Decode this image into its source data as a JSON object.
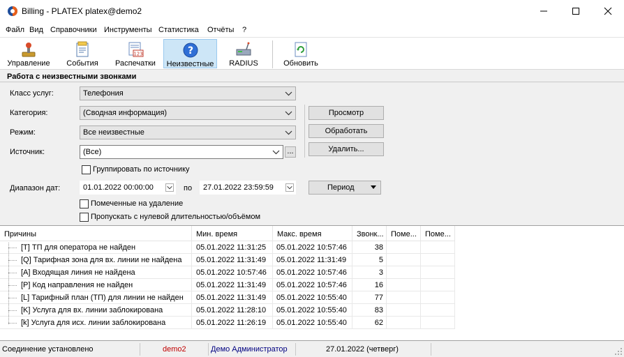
{
  "window": {
    "title": "Billing - PLATEX platex@demo2"
  },
  "menu": [
    "Файл",
    "Вид",
    "Справочники",
    "Инструменты",
    "Статистика",
    "Отчёты",
    "?"
  ],
  "toolbar": {
    "buttons": [
      {
        "label": "Управление",
        "icon": "joystick-icon"
      },
      {
        "label": "События",
        "icon": "events-icon"
      },
      {
        "label": "Распечатки",
        "icon": "printouts-icon",
        "badge": "123"
      },
      {
        "label": "Неизвестные",
        "icon": "question-icon",
        "active": true
      },
      {
        "label": "RADIUS",
        "icon": "radius-server-icon"
      },
      {
        "label": "Обновить",
        "icon": "refresh-icon"
      }
    ]
  },
  "section": {
    "title": "Работа с неизвестными звонками"
  },
  "form": {
    "service_class_label": "Класс услуг:",
    "service_class_value": "Телефония",
    "category_label": "Категория:",
    "category_value": "(Сводная информация)",
    "mode_label": "Режим:",
    "mode_value": "Все неизвестные",
    "source_label": "Источник:",
    "source_value": "(Все)",
    "browse_label": "...",
    "group_by_source_label": "Группировать по источнику",
    "date_range_label": "Диапазон дат:",
    "date_from": "01.01.2022 00:00:00",
    "date_to_label": "по",
    "date_to": "27.01.2022 23:59:59",
    "period_label": "Период",
    "marked_for_deletion_label": "Помеченные на удаление",
    "skip_zero_label": "Пропускать с нулевой длительностью/объёмом"
  },
  "actions": {
    "view": "Просмотр",
    "process": "Обработать",
    "delete": "Удалить..."
  },
  "table": {
    "columns": [
      "Причины",
      "Мин. время",
      "Макс. время",
      "Звонк...",
      "Поме...",
      "Поме..."
    ],
    "rows": [
      {
        "reason": "[T] ТП для оператора не найден",
        "min": "05.01.2022 11:31:25",
        "max": "05.01.2022 10:57:46",
        "calls": "38"
      },
      {
        "reason": "[Q] Тарифная зона для вх. линии не найдена",
        "min": "05.01.2022 11:31:49",
        "max": "05.01.2022 11:31:49",
        "calls": "5"
      },
      {
        "reason": "[A] Входящая  линия не найдена",
        "min": "05.01.2022 10:57:46",
        "max": "05.01.2022 10:57:46",
        "calls": "3"
      },
      {
        "reason": "[P] Код направления не найден",
        "min": "05.01.2022 11:31:49",
        "max": "05.01.2022 10:57:46",
        "calls": "16"
      },
      {
        "reason": "[L] Тарифный план (ТП) для линии не найден",
        "min": "05.01.2022 11:31:49",
        "max": "05.01.2022 10:55:40",
        "calls": "77"
      },
      {
        "reason": "[K] Услуга для вх. линии заблокирована",
        "min": "05.01.2022 11:28:10",
        "max": "05.01.2022 10:55:40",
        "calls": "83"
      },
      {
        "reason": "[k] Услуга для исх. линии заблокирована",
        "min": "05.01.2022 11:26:19",
        "max": "05.01.2022 10:55:40",
        "calls": "62"
      }
    ]
  },
  "status": {
    "connection": "Соединение установлено",
    "db": "demo2",
    "user": "Демо Администратор",
    "date": "27.01.2022 (четверг)",
    "db_color": "#c00000",
    "user_color": "#000080"
  }
}
